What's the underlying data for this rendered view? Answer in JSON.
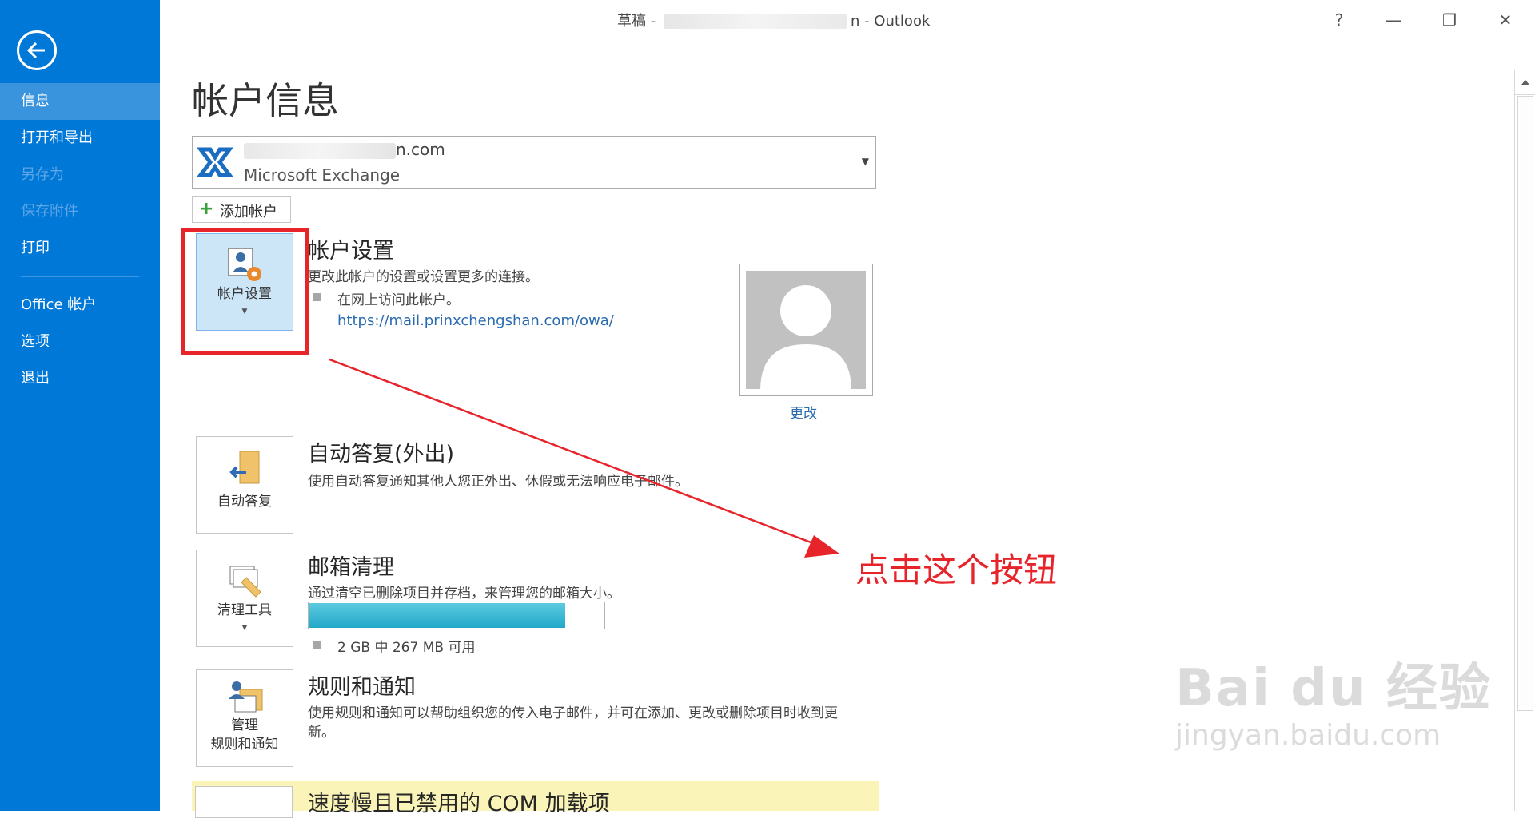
{
  "window": {
    "title_prefix": "草稿 - ",
    "title_suffix": "n - Outlook",
    "help": "?",
    "minimize": "—",
    "restore": "❐",
    "close": "✕"
  },
  "sidebar": {
    "back_icon": "back-arrow-icon",
    "items": [
      {
        "label": "信息",
        "state": "active"
      },
      {
        "label": "打开和导出",
        "state": "normal"
      },
      {
        "label": "另存为",
        "state": "disabled"
      },
      {
        "label": "保存附件",
        "state": "disabled"
      },
      {
        "label": "打印",
        "state": "normal"
      },
      {
        "label": "Office 帐户",
        "state": "normal"
      },
      {
        "label": "选项",
        "state": "normal"
      },
      {
        "label": "退出",
        "state": "normal"
      }
    ]
  },
  "main": {
    "title": "帐户信息",
    "account": {
      "email_fragment": "n.com",
      "type": "Microsoft Exchange"
    },
    "add_account_label": "添加帐户",
    "account_settings": {
      "tile_label": "帐户设置",
      "title": "帐户设置",
      "description": "更改此帐户的设置或设置更多的连接。",
      "bullet_text": "在网上访问此帐户。",
      "link": "https://mail.prinxchengshan.com/owa/"
    },
    "photo": {
      "change_label": "更改"
    },
    "auto_reply": {
      "tile_label": "自动答复",
      "title": "自动答复(外出)",
      "description": "使用自动答复通知其他人您正外出、休假或无法响应电子邮件。"
    },
    "mailbox_cleanup": {
      "tile_label": "清理工具",
      "title": "邮箱清理",
      "description": "通过清空已删除项目并存档，来管理您的邮箱大小。",
      "usage_fraction": 0.87,
      "usage_text": "2 GB 中 267 MB 可用"
    },
    "rules": {
      "tile_label_line1": "管理",
      "tile_label_line2": "规则和通知",
      "title": "规则和通知",
      "description_line1": "使用规则和通知可以帮助组织您的传入电子邮件，并可在添加、更改或删除项目时收到更",
      "description_line2": "新。"
    },
    "com_addins": {
      "title": "速度慢且已禁用的 COM 加载项"
    }
  },
  "annotation": {
    "text": "点击这个按钮",
    "color": "#e8242b"
  },
  "watermark": {
    "brand": "Bai du 经验",
    "url": "jingyan.baidu.com"
  },
  "colors": {
    "sidebar": "#0078d7",
    "sidebar_active": "#3a93dd",
    "link": "#2a6bb0",
    "selected_tile": "#cde6f7",
    "progress": "#22a8c8",
    "banner": "#fbf4b8"
  }
}
